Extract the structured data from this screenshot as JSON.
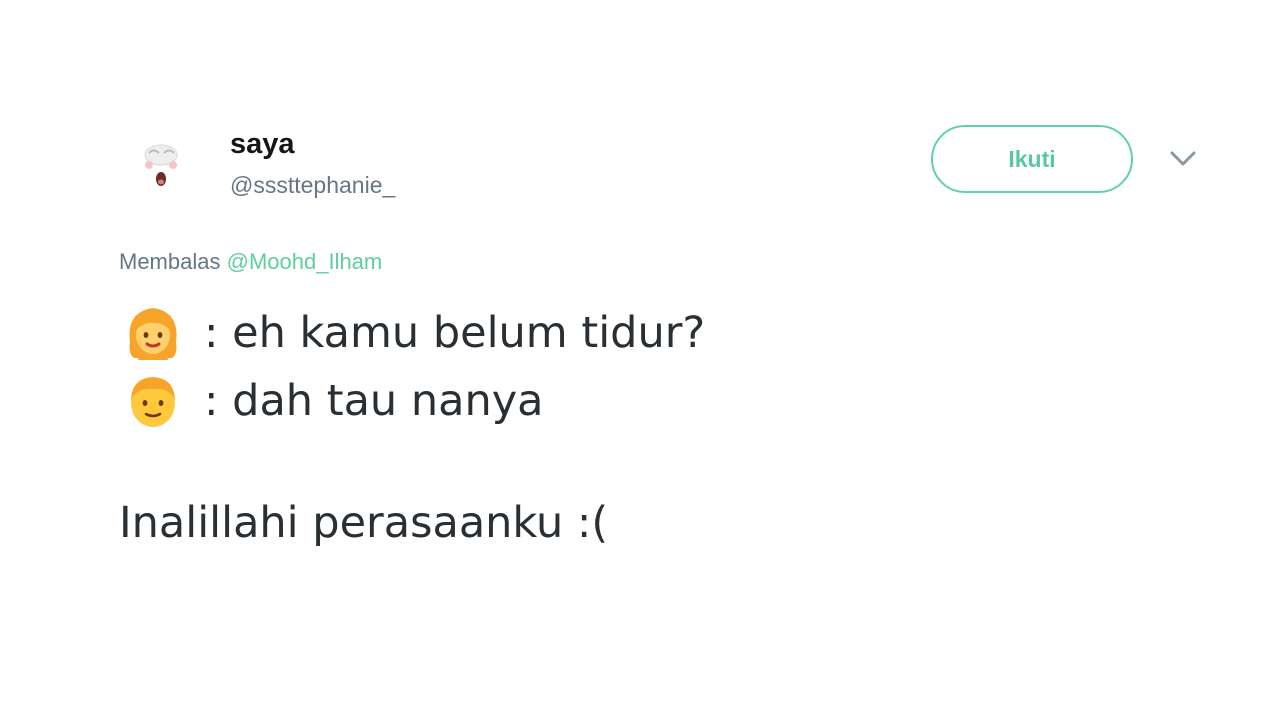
{
  "tweet": {
    "display_name": "saya",
    "handle": "@sssttephanie_",
    "follow_label": "Ikuti",
    "reply_prefix": "Membalas",
    "reply_mention": "@Moohd_Ilham",
    "lines": [
      {
        "emoji": "girl-emoji",
        "text": ": eh kamu belum tidur?"
      },
      {
        "emoji": "boy-emoji",
        "text": ": dah tau nanya"
      },
      {
        "text": "Inalillahi perasaanku :("
      }
    ]
  },
  "colors": {
    "accent": "#5fd3a8",
    "name": "#14171a",
    "secondary": "#657786",
    "body": "#292f33"
  }
}
